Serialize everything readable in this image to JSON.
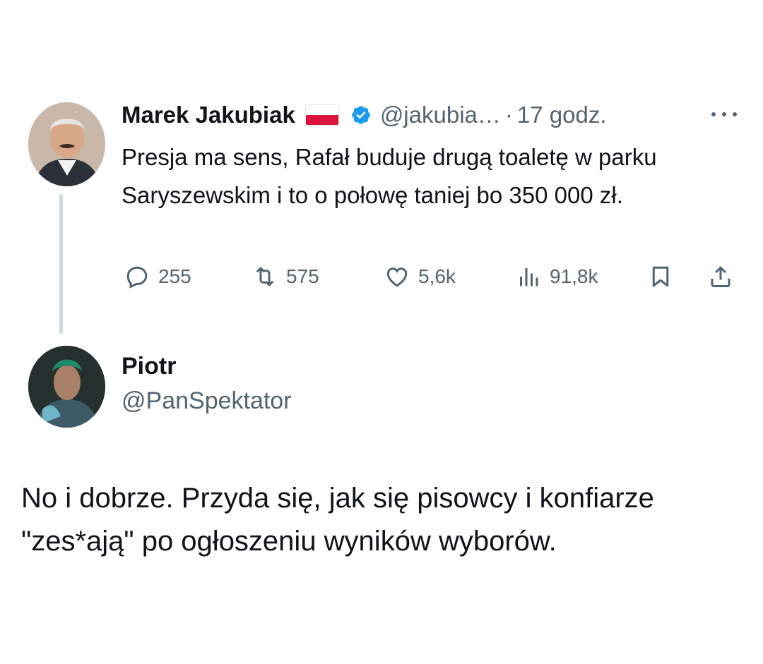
{
  "tweet": {
    "author": {
      "name": "Marek Jakubiak",
      "handle": "@jakubia…",
      "flag": "poland-flag",
      "verified": true,
      "verified_color": "#1d9bf0"
    },
    "separator": "·",
    "time": "17 godz.",
    "text": "Presja ma sens, Rafał buduje drugą toaletę w parku Saryszewskim i to o połowę taniej bo 350 000 zł.",
    "stats": {
      "replies": "255",
      "retweets": "575",
      "likes": "5,6k",
      "views": "91,8k"
    },
    "icons": {
      "more": "more-icon",
      "reply": "reply-icon",
      "retweet": "retweet-icon",
      "like": "heart-icon",
      "views": "views-icon",
      "bookmark": "bookmark-icon",
      "share": "share-icon"
    }
  },
  "reply": {
    "author": {
      "name": "Piotr",
      "handle": "@PanSpektator"
    },
    "text": "No i dobrze. Przyda się, jak się pisowcy i konfiarze \"zes*ają\" po ogłoszeniu wyników wyborów."
  },
  "colors": {
    "text_primary": "#0f1419",
    "text_secondary": "#536471",
    "thread_line": "#cfd9de",
    "flag_red": "#dc143c"
  }
}
